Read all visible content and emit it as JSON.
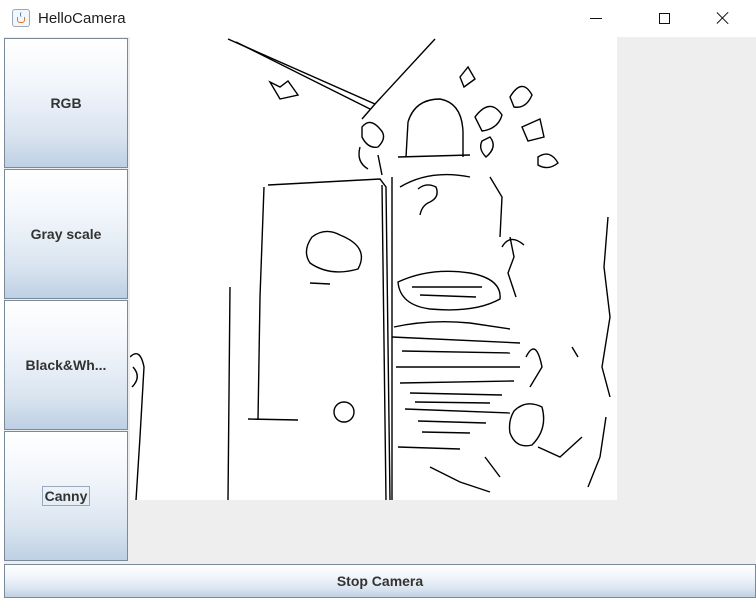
{
  "window": {
    "title": "HelloCamera",
    "app_icon": "java-cup-icon"
  },
  "sidebar": {
    "buttons": [
      {
        "label": "RGB"
      },
      {
        "label": "Gray scale"
      },
      {
        "label": "Black&Wh..."
      },
      {
        "label": "Canny"
      }
    ],
    "focused_index": 3
  },
  "video": {
    "mode": "Canny",
    "description_icon": "camera-feed-image"
  },
  "footer": {
    "stop_label": "Stop Camera"
  },
  "colors": {
    "button_gradient_top": "#ffffff",
    "button_gradient_bottom": "#bed0e3",
    "panel_bg": "#eeeeee",
    "edge_color": "#000000"
  }
}
